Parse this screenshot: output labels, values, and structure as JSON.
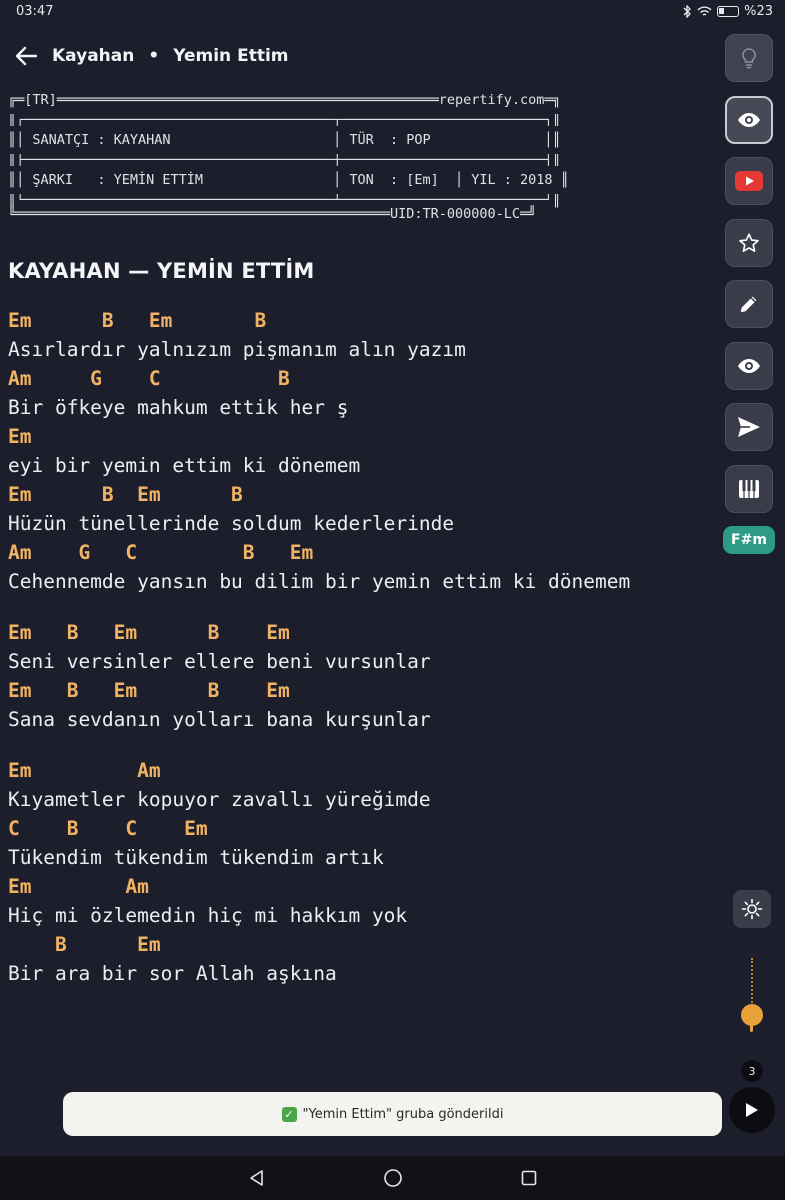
{
  "status": {
    "time": "03:47",
    "battery": "%23"
  },
  "header": {
    "artist": "Kayahan",
    "separator": "•",
    "song": "Yemin Ettim"
  },
  "info_box": {
    "lines": [
      "╔═[TR]═══════════════════════════════════════════════repertify.com═╗",
      "║┌──────────────────────────────────────┬─────────────────────────┐║",
      "║│ SANATÇI : KAYAHAN                    │ TÜR  : POP              │║",
      "║├──────────────────────────────────────┼─────────────────────────┤║",
      "║│ ŞARKI   : YEMİN ETTİM                │ TON  : [Em]  │ YIL : 2018 ║",
      "║└──────────────────────────────────────┴─────────────────────────┘║",
      "╚══════════════════════════════════════════════UID:TR-000000-LC═╝"
    ]
  },
  "song_title": "KAYAHAN — YEMİN ETTİM",
  "sheet": [
    {
      "chords": "Em      B   Em       B",
      "lyric": "Asırlardır yalnızım pişmanım alın yazım"
    },
    {
      "chords": "Am     G    C          B",
      "lyric": "Bir öfkeye mahkum ettik her ş"
    },
    {
      "chords": "Em",
      "lyric": "eyi bir yemin ettim ki dönemem"
    },
    {
      "chords": "Em      B  Em      B",
      "lyric": "Hüzün tünellerinde soldum kederlerinde"
    },
    {
      "chords": "Am    G   C         B   Em",
      "lyric": "Cehennemde yansın bu dilim bir yemin ettim ki dönemem",
      "gap_after": true
    },
    {
      "chords": "Em   B   Em      B    Em",
      "lyric": "Seni versinler ellere beni vursunlar"
    },
    {
      "chords": "Em   B   Em      B    Em",
      "lyric": "Sana sevdanın yolları bana kurşunlar",
      "gap_after": true
    },
    {
      "chords": "Em         Am",
      "lyric": "Kıyametler kopuyor zavallı yüreğimde"
    },
    {
      "chords": "C    B    C    Em",
      "lyric": "Tükendim tükendim tükendim artık"
    },
    {
      "chords": "Em        Am",
      "lyric": "Hiç mi özlemedin hiç mi hakkım yok"
    },
    {
      "chords": "    B      Em",
      "lyric": "Bir ara bir sor Allah aşkına"
    }
  ],
  "side_rail": {
    "icons": [
      "lightbulb-icon",
      "eye-icon",
      "youtube-icon",
      "star-icon",
      "pencil-icon",
      "eye-icon",
      "send-icon",
      "piano-icon"
    ],
    "key": "F#m"
  },
  "queue_count": "3",
  "toast": {
    "text": "\"Yemin Ettim\" gruba gönderildi"
  },
  "colors": {
    "background": "#1d1e2c",
    "chord": "#f0b363",
    "key_badge": "#2d9b88",
    "youtube": "#e53935",
    "slider": "#e7a33a"
  }
}
